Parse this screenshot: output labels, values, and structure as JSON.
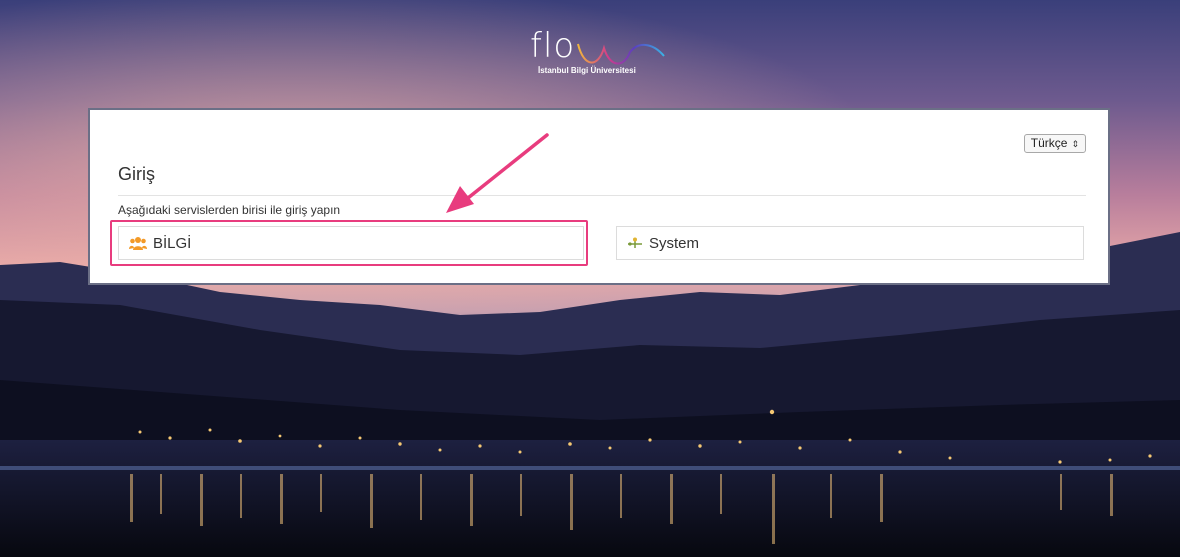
{
  "logo": {
    "text": "flo",
    "subtitle": "İstanbul Bilgi Üniversitesi"
  },
  "login": {
    "language_selector": "Türkçe",
    "title": "Giriş",
    "subtitle": "Aşağıdaki servislerden birisi ile giriş yapın",
    "services": [
      {
        "label": "BİLGİ",
        "icon": "users-icon"
      },
      {
        "label": "System",
        "icon": "network-icon"
      }
    ]
  },
  "annotation": {
    "highlight_color": "#e83c7e"
  }
}
